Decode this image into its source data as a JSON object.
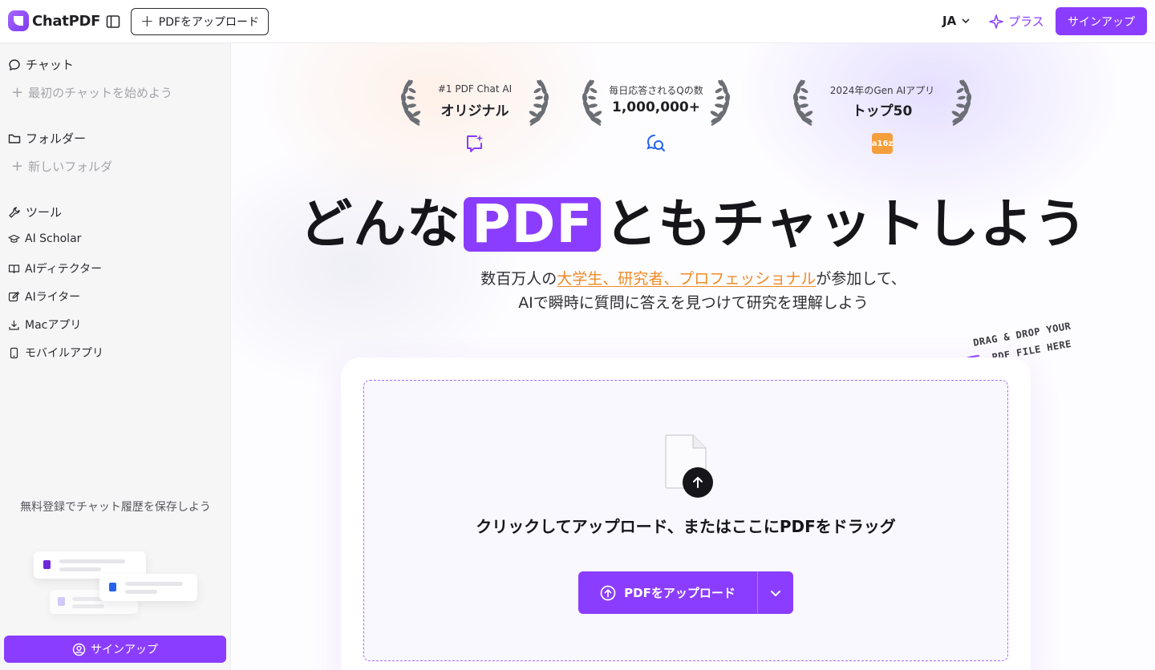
{
  "app": {
    "logo_text": "ChatPDF",
    "upload_button": "PDFをアップロード",
    "language": "JA",
    "plus_label": "プラス",
    "signup_label": "サインアップ",
    "accent_color": "#8b3dff"
  },
  "sidebar": {
    "chat_heading": "チャット",
    "chat_new": "最初のチャットを始めよう",
    "folder_heading": "フォルダー",
    "folder_new": "新しいフォルダ",
    "tools_heading": "ツール",
    "tools": [
      {
        "label": "AI Scholar",
        "icon": "graduation-cap-icon"
      },
      {
        "label": "AIディテクター",
        "icon": "book-open-icon"
      },
      {
        "label": "AIライター",
        "icon": "edit-icon"
      },
      {
        "label": "Macアプリ",
        "icon": "download-icon"
      },
      {
        "label": "モバイルアプリ",
        "icon": "smartphone-icon"
      }
    ],
    "save_note": "無料登録でチャット履歴を保存しよう",
    "signup_label": "サインアップ"
  },
  "awards": [
    {
      "small": "#1 PDF Chat AI",
      "big": "オリジナル",
      "icon": "sparkle-chat-icon"
    },
    {
      "small": "毎日応答されるQの数",
      "big": "1,000,000+",
      "icon": "search-chat-icon"
    },
    {
      "small": "2024年のGen AIアプリ",
      "big": "トップ50",
      "icon": "a16z-logo-icon",
      "badge_text": "a16z"
    }
  ],
  "hero": {
    "headline_before": "どんな",
    "headline_highlight": "PDF",
    "headline_after": "ともチャットしよう",
    "sub_line1_before": "数百万人の",
    "sub_line1_link": "大学生、研究者、プロフェッショナル",
    "sub_line1_after": "が参加して、",
    "sub_line2": "AIで瞬時に質問に答えを見つけて研究を理解しよう",
    "drag_hint_line1": "DRAG & DROP YOUR",
    "drag_hint_line2": "PDF FILE HERE"
  },
  "dropzone": {
    "text": "クリックしてアップロード、またはここにPDFをドラッグ",
    "button_label": "PDFをアップロード"
  }
}
